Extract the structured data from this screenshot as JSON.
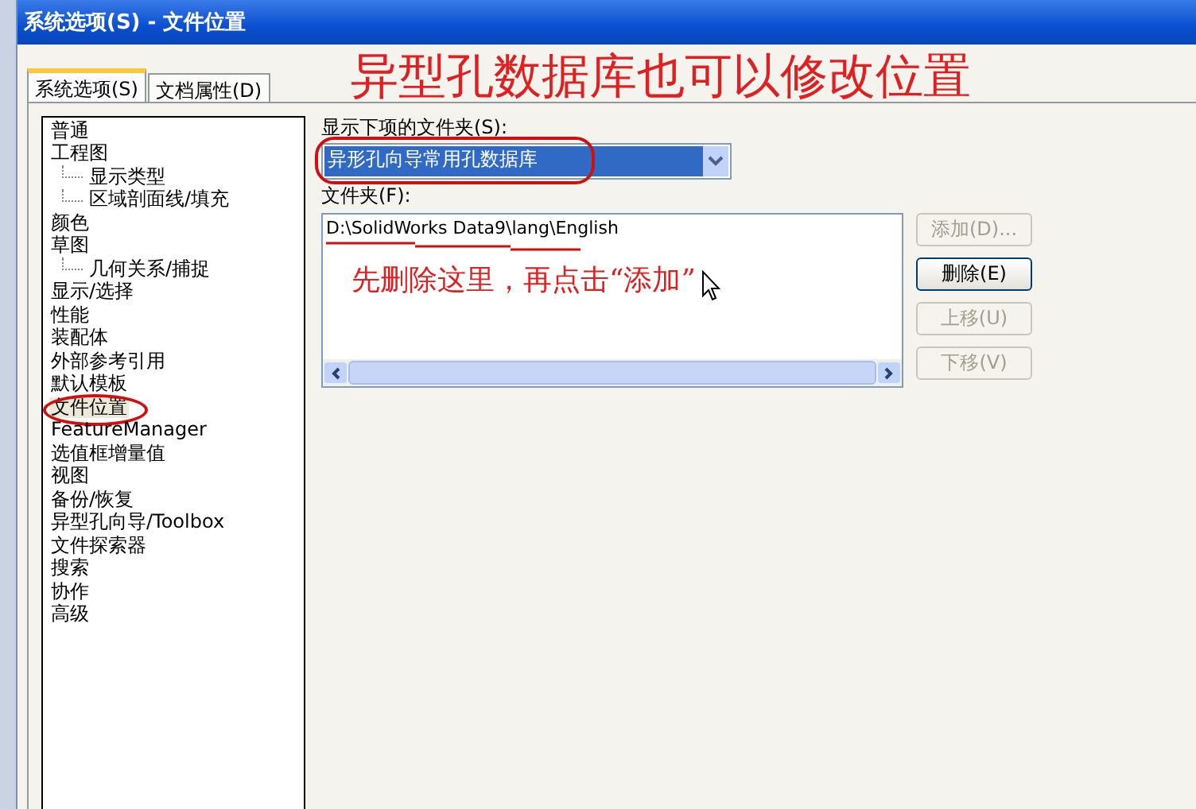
{
  "window": {
    "title": "系统选项(S) - 文件位置"
  },
  "tabs": [
    {
      "label": "系统选项(S)",
      "selected": true
    },
    {
      "label": "文档属性(D)",
      "selected": false
    }
  ],
  "tree": [
    {
      "label": "普通",
      "selected": false
    },
    {
      "label": "工程图",
      "selected": false,
      "children": [
        {
          "label": "显示类型",
          "selected": false
        },
        {
          "label": "区域剖面线/填充",
          "selected": false
        }
      ]
    },
    {
      "label": "颜色",
      "selected": false
    },
    {
      "label": "草图",
      "selected": false,
      "children": [
        {
          "label": "几何关系/捕捉",
          "selected": false
        }
      ]
    },
    {
      "label": "显示/选择",
      "selected": false
    },
    {
      "label": "性能",
      "selected": false
    },
    {
      "label": "装配体",
      "selected": false
    },
    {
      "label": "外部参考引用",
      "selected": false
    },
    {
      "label": "默认模板",
      "selected": false
    },
    {
      "label": "文件位置",
      "selected": true
    },
    {
      "label": "FeatureManager",
      "selected": false
    },
    {
      "label": "选值框增量值",
      "selected": false
    },
    {
      "label": "视图",
      "selected": false
    },
    {
      "label": "备份/恢复",
      "selected": false
    },
    {
      "label": "异型孔向导/Toolbox",
      "selected": false
    },
    {
      "label": "文件探索器",
      "selected": false
    },
    {
      "label": "搜索",
      "selected": false
    },
    {
      "label": "协作",
      "selected": false
    },
    {
      "label": "高级",
      "selected": false
    }
  ],
  "folder_type": {
    "label": "显示下项的文件夹(S):",
    "value": "异形孔向导常用孔数据库"
  },
  "folders": {
    "label": "文件夹(F):",
    "items": [
      "D:\\SolidWorks Data9\\lang\\English"
    ]
  },
  "buttons": [
    {
      "label": "添加(D)...",
      "disabled": true
    },
    {
      "label": "删除(E)",
      "disabled": false
    },
    {
      "label": "上移(U)",
      "disabled": true
    },
    {
      "label": "下移(V)",
      "disabled": true
    }
  ],
  "annotations": {
    "heading": "异型孔数据库也可以修改位置",
    "note": "先删除这里，再点击“添加”"
  }
}
